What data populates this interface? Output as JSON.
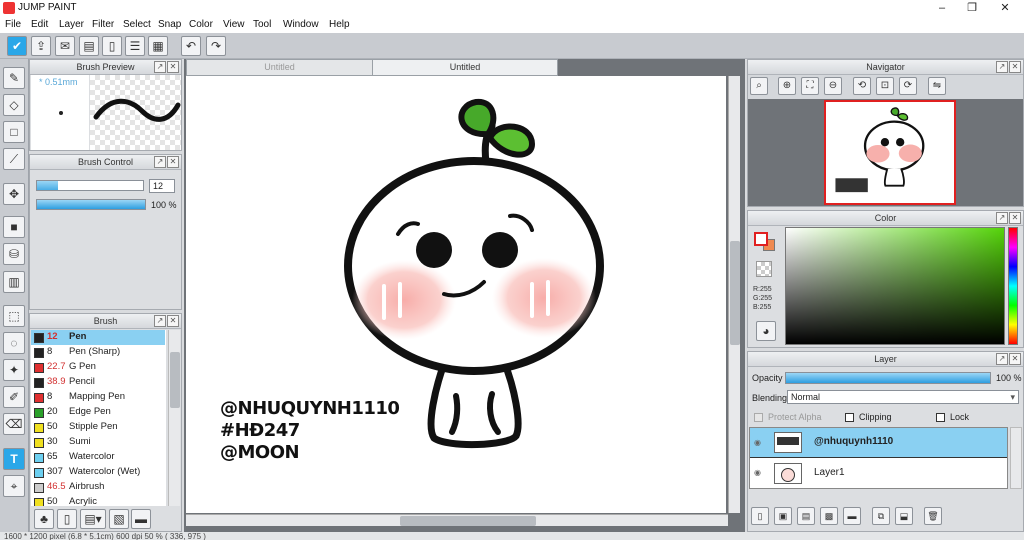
{
  "window": {
    "title": "JUMP PAINT",
    "min": "–",
    "max": "❐",
    "close": "✕"
  },
  "menu": [
    "File",
    "Edit",
    "Layer",
    "Filter",
    "Select",
    "Snap",
    "Color",
    "View",
    "Tool",
    "Window",
    "Help"
  ],
  "brush_preview": {
    "title": "Brush Preview",
    "size": "* 0.51mm"
  },
  "brush_control": {
    "title": "Brush Control",
    "size_value": "12",
    "opacity_value": "100 %",
    "size_fill": 0.2,
    "opacity_fill": 1.0
  },
  "brush": {
    "title": "Brush",
    "items": [
      {
        "size": "12",
        "name": "Pen",
        "color": "#222222",
        "size_red": true,
        "selected": true
      },
      {
        "size": "8",
        "name": "Pen (Sharp)",
        "color": "#222222",
        "size_red": false
      },
      {
        "size": "22.7",
        "name": "G Pen",
        "color": "#e03030",
        "size_red": true
      },
      {
        "size": "38.9",
        "name": "Pencil",
        "color": "#222222",
        "size_red": true
      },
      {
        "size": "8",
        "name": "Mapping Pen",
        "color": "#e03030",
        "size_red": false
      },
      {
        "size": "20",
        "name": "Edge Pen",
        "color": "#2aa02a",
        "size_red": false
      },
      {
        "size": "50",
        "name": "Stipple Pen",
        "color": "#f0e020",
        "size_red": false
      },
      {
        "size": "30",
        "name": "Sumi",
        "color": "#f0e020",
        "size_red": false
      },
      {
        "size": "65",
        "name": "Watercolor",
        "color": "#6ccff0",
        "size_red": false
      },
      {
        "size": "307",
        "name": "Watercolor (Wet)",
        "color": "#6ccff0",
        "size_red": false
      },
      {
        "size": "46.5",
        "name": "Airbrush",
        "color": "#cccccc",
        "size_red": true
      },
      {
        "size": "50",
        "name": "Acrylic",
        "color": "#f0e020",
        "size_red": false
      }
    ]
  },
  "tabs": [
    {
      "label": "Untitled",
      "active": false
    },
    {
      "label": "Untitled",
      "active": true
    }
  ],
  "canvas_text": [
    "@NHUQUYNH1110",
    "#HĐ247",
    "@MOON"
  ],
  "navigator": {
    "title": "Navigator"
  },
  "color": {
    "title": "Color",
    "r": "R:255",
    "g": "G:255",
    "b": "B:255",
    "main": "#ffffff",
    "sub": "#f08a50"
  },
  "layer": {
    "title": "Layer",
    "opacity_label": "Opacity",
    "opacity_value": "100 %",
    "blending_label": "Blending",
    "blending_value": "Normal",
    "protect_alpha": "Protect Alpha",
    "clipping": "Clipping",
    "lock": "Lock",
    "items": [
      {
        "name": "@nhuquynh1110",
        "selected": true
      },
      {
        "name": "Layer1",
        "selected": false
      }
    ]
  },
  "status": "1600 * 1200 pixel  (6.8 * 5.1cm)  600 dpi  50 %  ( 336, 975 )"
}
